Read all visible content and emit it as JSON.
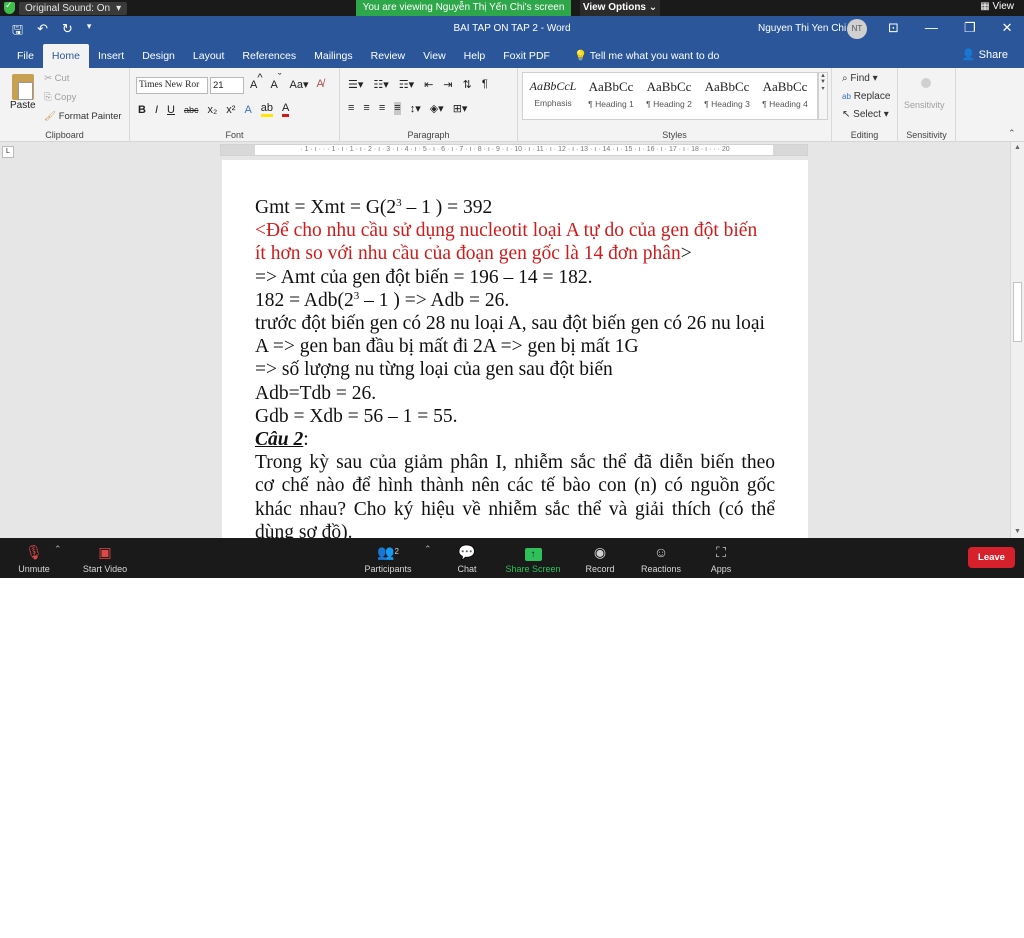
{
  "zoom_top": {
    "sound_label": "Original Sound: On",
    "viewing_banner": "You are viewing Nguyễn Thị Yến Chi's screen",
    "view_options": "View Options",
    "view_menu": "View"
  },
  "titlebar": {
    "title": "BAI TAP ON TAP 2  -  Word",
    "user_name": "Nguyen Thi Yen Chi",
    "user_initials": "NT"
  },
  "tabs": [
    "File",
    "Home",
    "Insert",
    "Design",
    "Layout",
    "References",
    "Mailings",
    "Review",
    "View",
    "Help",
    "Foxit PDF"
  ],
  "tell_me": "Tell me what you want to do",
  "share": "Share",
  "ribbon": {
    "clipboard": {
      "paste": "Paste",
      "cut": "Cut",
      "copy": "Copy",
      "format_painter": "Format Painter",
      "label": "Clipboard"
    },
    "font": {
      "name": "Times New Ror",
      "size": "21",
      "label": "Font"
    },
    "paragraph": {
      "label": "Paragraph"
    },
    "styles": {
      "label": "Styles",
      "items": [
        {
          "sample": "AaBbCcL",
          "name": "Emphasis"
        },
        {
          "sample": "AaBbCc",
          "name": "¶ Heading 1"
        },
        {
          "sample": "AaBbCc",
          "name": "¶ Heading 2"
        },
        {
          "sample": "AaBbCc",
          "name": "¶ Heading 3"
        },
        {
          "sample": "AaBbCc",
          "name": "¶ Heading 4"
        }
      ]
    },
    "editing": {
      "find": "Find",
      "replace": "Replace",
      "select": "Select",
      "label": "Editing"
    },
    "sensitivity": {
      "button": "Sensitivity",
      "label": "Sensitivity"
    }
  },
  "ruler_text": "· 1 · ı · · · 1 · ı · 1 · ı · 2 · ı · 3 · ı · 4 · ı · 5 · ı · 6 · ı · 7 · ı · 8 · ı · 9 · ı · 10 · ı · 11 · ı · 12 · ı · 13 · ı · 14 · ı · 15 · ı · 16 · ı · 17 · ı · 18 · ı · · · 20",
  "document": {
    "l1_pre": "Gmt = Xmt = G(2",
    "l1_sup": "3",
    "l1_post": " – 1 ) = 392",
    "l2": "<Để cho nhu cầu sử dụng nucleotit loại A tự do của gen đột biến",
    "l3_red": "ít hơn so với nhu cầu của đoạn gen gốc là 14 đơn phân",
    "l3_black": ">",
    "l4": "=> Amt của gen đột biến = 196 – 14 = 182.",
    "l5_pre": "182 = Adb(2",
    "l5_sup": "3",
    "l5_post": " – 1 ) => Adb = 26.",
    "l6": "trước đột biến gen có 28 nu loại A, sau đột biến gen có 26 nu loại",
    "l7": "A => gen ban đầu bị mất đi 2A => gen bị mất 1G",
    "l8": "=> số lượng nu từng loại của gen sau đột biến",
    "l9": "Adb=Tdb = 26.",
    "l10": "Gdb = Xdb = 56 – 1 = 55.",
    "heading": "Câu 2",
    "heading_colon": ":",
    "q1": "Trong kỳ sau của giảm phân I, nhiễm sắc thể đã diễn biến theo",
    "q2": "cơ chế nào để hình thành nên các tế bào con (n) có nguồn gốc",
    "q3": "khác nhau? Cho ký hiệu về nhiễm sắc thể và giải thích (có thể",
    "q4": "dùng sơ đồ)."
  },
  "zoom_bar": {
    "unmute": "Unmute",
    "start_video": "Start Video",
    "participants": "Participants",
    "participants_count": "2",
    "chat": "Chat",
    "share_screen": "Share Screen",
    "record": "Record",
    "reactions": "Reactions",
    "apps": "Apps",
    "leave": "Leave"
  },
  "colors": {
    "word_blue": "#2b579a",
    "zoom_green": "#2ea64a",
    "leave_red": "#d6212c",
    "doc_red": "#d11a1a"
  }
}
